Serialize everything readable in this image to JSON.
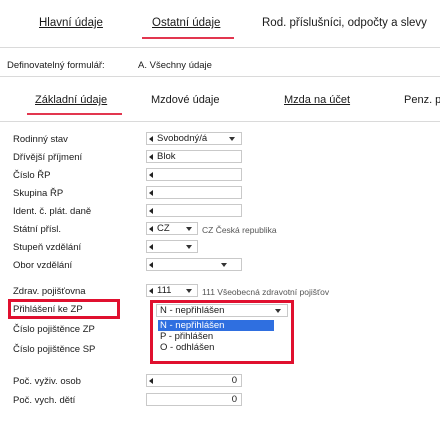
{
  "top_tabs": [
    {
      "label": "Hlavní údaje",
      "active": false
    },
    {
      "label": "Ostatní údaje",
      "active": true
    },
    {
      "label": "Rod. příslušníci, odpočty a slevy",
      "active": false
    }
  ],
  "form_selector": {
    "label": "Definovatelný formulář:",
    "value": "A. Všechny údaje"
  },
  "sub_tabs": [
    {
      "label": "Základní údaje",
      "active": true
    },
    {
      "label": "Mzdové údaje",
      "active": false
    },
    {
      "label": "Mzda na účet",
      "active": false
    },
    {
      "label": "Penz. p",
      "active": false
    }
  ],
  "fields": {
    "rodinny_stav": {
      "label": "Rodinný stav",
      "value": "Svobodný/á"
    },
    "drivejsi_prijmeni": {
      "label": "Dřívější příjmení",
      "value": "Blok"
    },
    "cislo_rp": {
      "label": "Číslo ŘP",
      "value": ""
    },
    "skupina_rp": {
      "label": "Skupina ŘP",
      "value": ""
    },
    "ident_plat_dane": {
      "label": "Ident. č. plát. daně",
      "value": ""
    },
    "statni_prisl": {
      "label": "Státní přísl.",
      "value": "CZ",
      "description": "CZ Česká republika"
    },
    "stupen_vzdelani": {
      "label": "Stupeň vzdělání",
      "value": ""
    },
    "obor_vzdelani": {
      "label": "Obor vzdělání",
      "value": ""
    },
    "zdrav_pojistovna": {
      "label": "Zdrav. pojišťovna",
      "value": "111",
      "description": "111 Všeobecná zdravotní pojišťov"
    },
    "prihlaseni_ke_zp": {
      "label": "Přihlášení ke ZP",
      "value": "N - nepřihlášen"
    },
    "cislo_pojistence_zp": {
      "label": "Číslo pojištěnce ZP",
      "value": ""
    },
    "cislo_pojistence_sp": {
      "label": "Číslo pojištěnce SP",
      "value": ""
    },
    "poc_vyziv_osob": {
      "label": "Poč. vyživ. osob",
      "value": "0"
    },
    "poc_vych_deti": {
      "label": "Poč. vych. dětí",
      "value": "0"
    }
  },
  "dropdown_options": [
    {
      "label": "N - nepřihlášen",
      "selected": true
    },
    {
      "label": "P - přihlášen",
      "selected": false
    },
    {
      "label": "O - odhlášen",
      "selected": false
    }
  ],
  "colors": {
    "accent": "#e2364f",
    "highlight_box": "#e0102f",
    "selection": "#2f6fe0"
  }
}
